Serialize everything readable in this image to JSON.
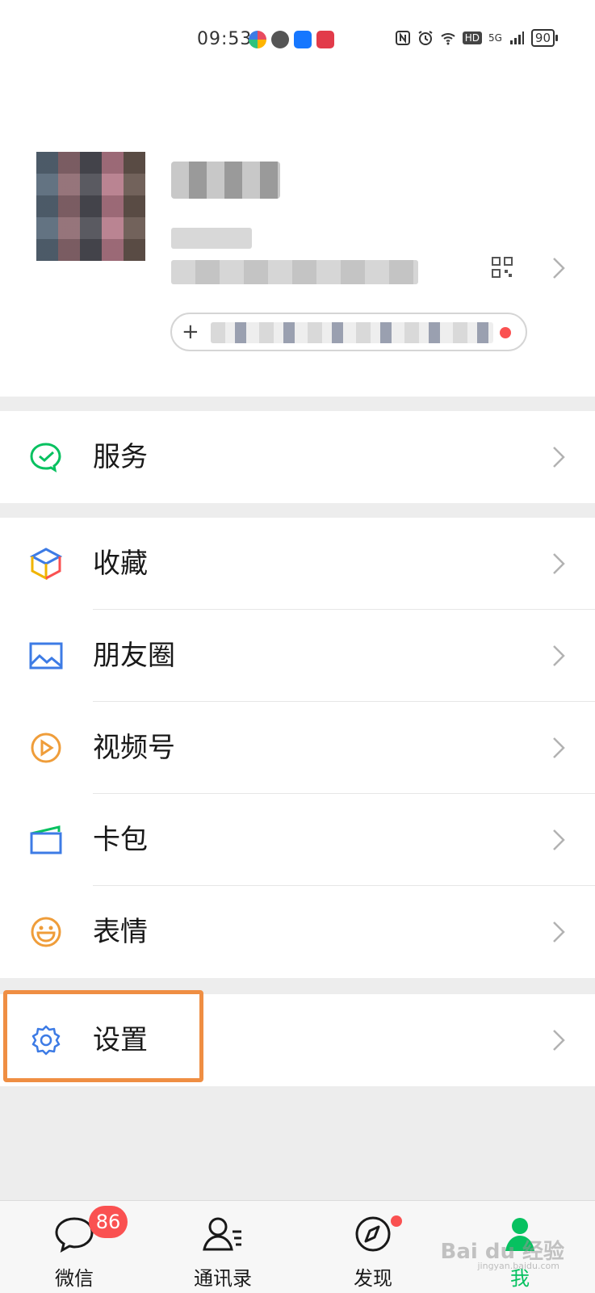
{
  "status_bar": {
    "time": "09:53",
    "battery": "90",
    "network": "5G",
    "hd": "HD"
  },
  "profile": {
    "status_plus": "+"
  },
  "menu": {
    "services": {
      "label": "服务",
      "icon": "wechat-pay-icon"
    },
    "favorites": {
      "label": "收藏",
      "icon": "cube-icon"
    },
    "moments": {
      "label": "朋友圈",
      "icon": "image-icon"
    },
    "channels": {
      "label": "视频号",
      "icon": "play-icon"
    },
    "card_wallet": {
      "label": "卡包",
      "icon": "card-icon"
    },
    "stickers": {
      "label": "表情",
      "icon": "smile-icon"
    },
    "settings": {
      "label": "设置",
      "icon": "gear-icon"
    }
  },
  "tabbar": {
    "chats": {
      "label": "微信",
      "badge": "86"
    },
    "contacts": {
      "label": "通讯录"
    },
    "discover": {
      "label": "发现"
    },
    "me": {
      "label": "我"
    }
  },
  "watermark": {
    "text": "Bai du 经验",
    "sub": "jingyan.baidu.com"
  },
  "colors": {
    "accent_green": "#07c160",
    "badge_red": "#fa5151",
    "highlight_orange": "#ef8e43",
    "background": "#ededed"
  }
}
